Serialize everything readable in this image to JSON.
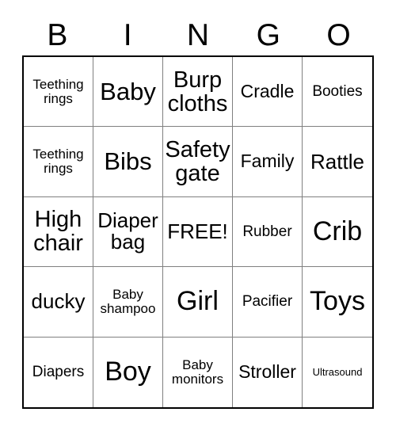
{
  "card": {
    "title_letters": [
      "B",
      "I",
      "N",
      "G",
      "O"
    ],
    "free_space_label": "FREE!",
    "grid_size": "5x5",
    "border_color": "#000000",
    "cell_border_color": "#808080",
    "background_color": "#ffffff",
    "text_color": "#000000"
  },
  "rows": [
    {
      "cells": [
        {
          "text": "Teething\nrings",
          "size": "sm"
        },
        {
          "text": "Baby",
          "size": "3xl"
        },
        {
          "text": "Burp\ncloths",
          "size": "2xl"
        },
        {
          "text": "Cradle",
          "size": "lg"
        },
        {
          "text": "Booties",
          "size": "md"
        }
      ]
    },
    {
      "cells": [
        {
          "text": "Teething\nrings",
          "size": "sm"
        },
        {
          "text": "Bibs",
          "size": "3xl"
        },
        {
          "text": "Safety\ngate",
          "size": "2xl"
        },
        {
          "text": "Family",
          "size": "lg"
        },
        {
          "text": "Rattle",
          "size": "xl"
        }
      ]
    },
    {
      "cells": [
        {
          "text": "High\nchair",
          "size": "2xl"
        },
        {
          "text": "Diaper\nbag",
          "size": "xl"
        },
        {
          "text": "FREE!",
          "size": "xl"
        },
        {
          "text": "Rubber",
          "size": "md"
        },
        {
          "text": "Crib",
          "size": "4xl"
        }
      ]
    },
    {
      "cells": [
        {
          "text": "ducky",
          "size": "xl"
        },
        {
          "text": "Baby\nshampoo",
          "size": "sm"
        },
        {
          "text": "Girl",
          "size": "4xl"
        },
        {
          "text": "Pacifier",
          "size": "md"
        },
        {
          "text": "Toys",
          "size": "4xl"
        }
      ]
    },
    {
      "cells": [
        {
          "text": "Diapers",
          "size": "md"
        },
        {
          "text": "Boy",
          "size": "4xl"
        },
        {
          "text": "Baby\nmonitors",
          "size": "sm"
        },
        {
          "text": "Stroller",
          "size": "lg"
        },
        {
          "text": "Ultrasound",
          "size": "xs"
        }
      ]
    }
  ]
}
